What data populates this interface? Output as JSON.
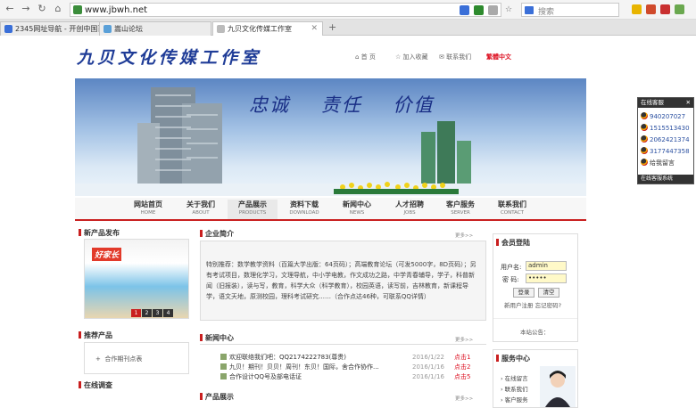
{
  "browser": {
    "url": "www.jbwh.net",
    "search_placeholder": "搜索",
    "tabs": [
      {
        "label": "2345网址导航 - 开创中国百年品牌",
        "active": false
      },
      {
        "label": "嵩山论坛",
        "active": false
      },
      {
        "label": "九贝文化传媒工作室",
        "active": true
      }
    ],
    "new_tab_glyph": "+"
  },
  "site": {
    "logo": "九贝文化传媒工作室",
    "top_links": [
      "首 页",
      "加入收藏",
      "联系我们",
      "繁體中文"
    ],
    "banner_slogan": "忠诚    责任    价值"
  },
  "nav": [
    {
      "cn": "网站首页",
      "en": "HOME"
    },
    {
      "cn": "关于我们",
      "en": "ABOUT"
    },
    {
      "cn": "产品展示",
      "en": "PRODUCTS"
    },
    {
      "cn": "资料下载",
      "en": "DOWNLOAD"
    },
    {
      "cn": "新闻中心",
      "en": "NEWS"
    },
    {
      "cn": "人才招聘",
      "en": "JOBS"
    },
    {
      "cn": "客户服务",
      "en": "SERVER"
    },
    {
      "cn": "联系我们",
      "en": "CONTACT"
    }
  ],
  "left": {
    "new_products_title": "新产品发布",
    "product_image_text": "好家长",
    "slider_pages": [
      "1",
      "2",
      "3",
      "4"
    ],
    "recommended_title": "推荐产品",
    "recommended_item": "合作期刊点表",
    "survey_title": "在线调查"
  },
  "center": {
    "company_title": "企业简介",
    "more": "更多>>",
    "company_text": "特别推荐：数学教学资料（百篇大学出版：64页码）；高端教育论坛（可发5000字，8D页码）；另有考试项目，数理化学习，文理导航，中小学电教，作文成功之路，中学青春辅导，学子，科普新闻（旧报装），读与写，教育，科学大众（科学教育），校园英语，读写前，吉林教育，新课程导学，语文天地，原测校园，理科考试研究……（合作点达46种，可联系QQ详情）",
    "news_title": "新闻中心",
    "news": [
      {
        "title": "欢迎联络我们吧：QQ2174222783(尊贵)",
        "date": "2016/1/22",
        "hits_label": "点击",
        "hits": "1"
      },
      {
        "title": "九贝！期刊！贝贝！周刊！东贝！国际，舍合作协作...",
        "date": "2016/1/16",
        "hits_label": "点击",
        "hits": "2"
      },
      {
        "title": "合作设计QQ号及部电话证",
        "date": "2016/1/16",
        "hits_label": "点击",
        "hits": "5"
      }
    ],
    "products_title": "产品展示"
  },
  "right": {
    "login_title": "会员登陆",
    "username_label": "用户名:",
    "username_value": "admin",
    "password_label": "密 码:",
    "password_value": "•••••",
    "login_button": "登录",
    "reset_button": "清空",
    "register_link": "新用户注册",
    "forgot_link": "忘记密码?",
    "notice_label": "本站公告：",
    "service_title": "服务中心",
    "service_links": [
      "在线留言",
      "联系我们",
      "客户服务"
    ]
  },
  "qq_widget": {
    "header": "在线客服",
    "numbers": [
      "940207027",
      "1515513430",
      "2062421374",
      "3177447358"
    ],
    "leave_message": "给我留言",
    "footer": "在线客服系统"
  }
}
